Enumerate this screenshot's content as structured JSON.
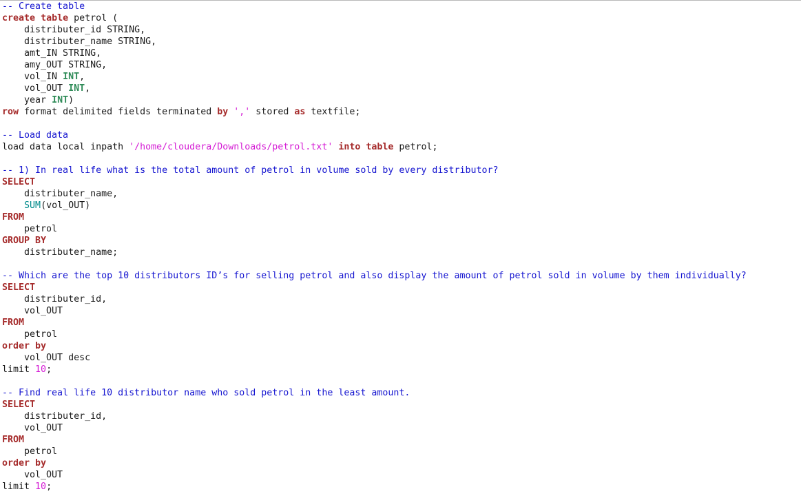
{
  "editor": {
    "lines": [
      [
        {
          "t": "comment",
          "v": "-- Create table"
        }
      ],
      [
        {
          "t": "keyword",
          "v": "create"
        },
        {
          "t": "plain",
          "v": " "
        },
        {
          "t": "keyword",
          "v": "table"
        },
        {
          "t": "plain",
          "v": " petrol ("
        }
      ],
      [
        {
          "t": "plain",
          "v": "    distributer_id STRING,"
        }
      ],
      [
        {
          "t": "plain",
          "v": "    distributer_name STRING,"
        }
      ],
      [
        {
          "t": "plain",
          "v": "    amt_IN STRING,"
        }
      ],
      [
        {
          "t": "plain",
          "v": "    amy_OUT STRING,"
        }
      ],
      [
        {
          "t": "plain",
          "v": "    vol_IN "
        },
        {
          "t": "type",
          "v": "INT"
        },
        {
          "t": "plain",
          "v": ","
        }
      ],
      [
        {
          "t": "plain",
          "v": "    vol_OUT "
        },
        {
          "t": "type",
          "v": "INT"
        },
        {
          "t": "plain",
          "v": ","
        }
      ],
      [
        {
          "t": "plain",
          "v": "    year "
        },
        {
          "t": "type",
          "v": "INT"
        },
        {
          "t": "plain",
          "v": ")"
        }
      ],
      [
        {
          "t": "keyword",
          "v": "row"
        },
        {
          "t": "plain",
          "v": " format delimited fields terminated "
        },
        {
          "t": "keyword",
          "v": "by"
        },
        {
          "t": "plain",
          "v": " "
        },
        {
          "t": "string",
          "v": "','"
        },
        {
          "t": "plain",
          "v": " stored "
        },
        {
          "t": "keyword",
          "v": "as"
        },
        {
          "t": "plain",
          "v": " textfile;"
        }
      ],
      [],
      [
        {
          "t": "comment",
          "v": "-- Load data"
        }
      ],
      [
        {
          "t": "plain",
          "v": "load data local inpath "
        },
        {
          "t": "string",
          "v": "'/home/cloudera/Downloads/petrol.txt'"
        },
        {
          "t": "plain",
          "v": " "
        },
        {
          "t": "keyword",
          "v": "into"
        },
        {
          "t": "plain",
          "v": " "
        },
        {
          "t": "keyword",
          "v": "table"
        },
        {
          "t": "plain",
          "v": " petrol;"
        }
      ],
      [],
      [
        {
          "t": "comment",
          "v": "-- 1) In real life what is the total amount of petrol in volume sold by every distributor?"
        }
      ],
      [
        {
          "t": "keyword",
          "v": "SELECT"
        }
      ],
      [
        {
          "t": "plain",
          "v": "    distributer_name,"
        }
      ],
      [
        {
          "t": "plain",
          "v": "    "
        },
        {
          "t": "function",
          "v": "SUM"
        },
        {
          "t": "plain",
          "v": "(vol_OUT)"
        }
      ],
      [
        {
          "t": "keyword",
          "v": "FROM"
        }
      ],
      [
        {
          "t": "plain",
          "v": "    petrol"
        }
      ],
      [
        {
          "t": "keyword",
          "v": "GROUP BY"
        }
      ],
      [
        {
          "t": "plain",
          "v": "    distributer_name;"
        }
      ],
      [],
      [
        {
          "t": "comment",
          "v": "-- Which are the top 10 distributors ID’s for selling petrol and also display the amount of petrol sold in volume by them individually?"
        }
      ],
      [
        {
          "t": "keyword",
          "v": "SELECT"
        }
      ],
      [
        {
          "t": "plain",
          "v": "    distributer_id,"
        }
      ],
      [
        {
          "t": "plain",
          "v": "    vol_OUT"
        }
      ],
      [
        {
          "t": "keyword",
          "v": "FROM"
        }
      ],
      [
        {
          "t": "plain",
          "v": "    petrol"
        }
      ],
      [
        {
          "t": "keyword",
          "v": "order by"
        }
      ],
      [
        {
          "t": "plain",
          "v": "    vol_OUT desc"
        }
      ],
      [
        {
          "t": "plain",
          "v": "limit "
        },
        {
          "t": "number",
          "v": "10"
        },
        {
          "t": "plain",
          "v": ";"
        }
      ],
      [],
      [
        {
          "t": "comment",
          "v": "-- Find real life 10 distributor name who sold petrol in the least amount."
        }
      ],
      [
        {
          "t": "keyword",
          "v": "SELECT"
        }
      ],
      [
        {
          "t": "plain",
          "v": "    distributer_id,"
        }
      ],
      [
        {
          "t": "plain",
          "v": "    vol_OUT"
        }
      ],
      [
        {
          "t": "keyword",
          "v": "FROM"
        }
      ],
      [
        {
          "t": "plain",
          "v": "    petrol"
        }
      ],
      [
        {
          "t": "keyword",
          "v": "order by"
        }
      ],
      [
        {
          "t": "plain",
          "v": "    vol_OUT"
        }
      ],
      [
        {
          "t": "plain",
          "v": "limit "
        },
        {
          "t": "number",
          "v": "10"
        },
        {
          "t": "plain",
          "v": ";"
        }
      ]
    ]
  },
  "colors": {
    "background": "#ffffff",
    "text": "#1a1a1a",
    "keyword": "#a52a2a",
    "comment": "#1515d0",
    "string": "#d41ad4",
    "number": "#d41ad4",
    "type": "#2e8b57",
    "function": "#008b8b"
  }
}
